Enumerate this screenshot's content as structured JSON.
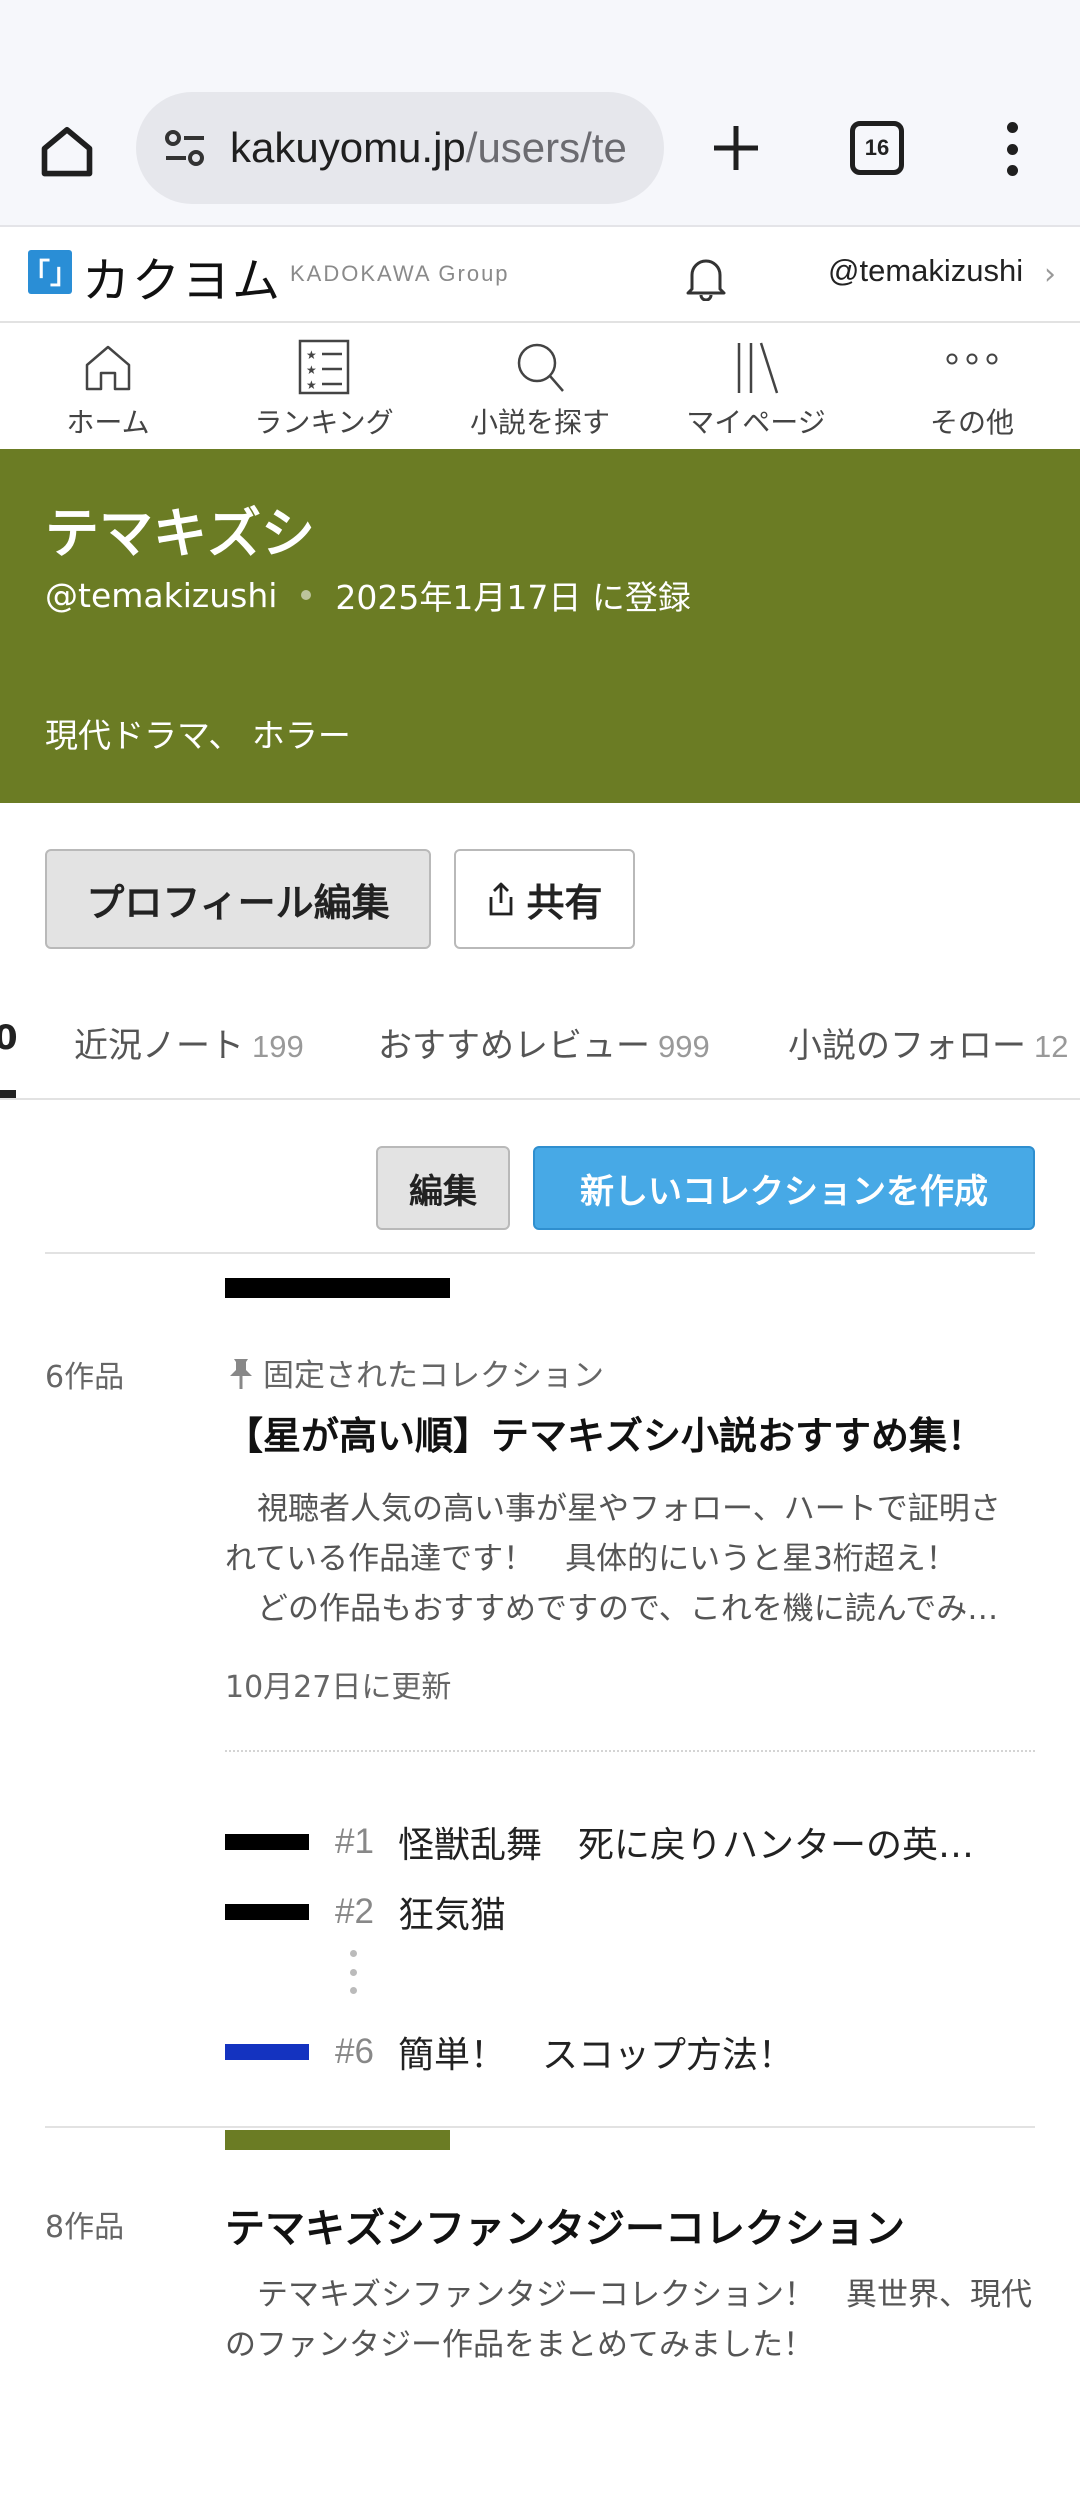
{
  "browser": {
    "url_main": "kakuyomu.jp",
    "url_rest": "/users/te",
    "tab_count": "16"
  },
  "header": {
    "logo_mark": "「」",
    "logo_text": "カクヨム",
    "group": "KADOKAWA Group",
    "user_handle": "@temakizushi"
  },
  "nav": {
    "items": [
      {
        "label": "ホーム",
        "icon": "home-icon"
      },
      {
        "label": "ランキング",
        "icon": "ranking-icon"
      },
      {
        "label": "小説を探す",
        "icon": "search-icon"
      },
      {
        "label": "マイページ",
        "icon": "mypage-icon"
      },
      {
        "label": "その他",
        "icon": "more-icon"
      }
    ]
  },
  "profile": {
    "name": "テマキズシ",
    "handle": "@temakizushi",
    "registered": "2025年1月17日 に登録",
    "genres": "現代ドラマ、 ホラー",
    "band_color": "#6b7c24"
  },
  "actions": {
    "edit_profile": "プロフィール編集",
    "share": "共有"
  },
  "tabs": {
    "first_partial": "0",
    "items": [
      {
        "label": "近況ノート",
        "count": "199"
      },
      {
        "label": "おすすめレビュー",
        "count": "999"
      },
      {
        "label": "小説のフォロー",
        "count": "12"
      }
    ]
  },
  "collection_actions": {
    "edit": "編集",
    "create": "新しいコレクションを作成",
    "create_color": "#47a9e6"
  },
  "collections": [
    {
      "count": "6作品",
      "pinned_label": "固定されたコレクション",
      "title": "【星が高い順】テマキズシ小説おすすめ集！",
      "desc_lines": [
        "視聴者人気の高い事が星やフォロー、ハートで証明さ",
        "れている作品達です！　具体的にいうと星3桁超え！",
        "どの作品もおすすめですので、これを機に読んでみ…"
      ],
      "updated": "10月27日に更新",
      "works": [
        {
          "num": "#1",
          "title": "怪獣乱舞　死に戻りハンターの英…",
          "color": "#000000"
        },
        {
          "num": "#2",
          "title": "狂気猫",
          "color": "#000000"
        },
        {
          "num": "#6",
          "title": "簡単！　スコップ方法！",
          "color": "#1433c0"
        }
      ]
    },
    {
      "count": "8作品",
      "title": "テマキズシファンタジーコレクション",
      "desc": "テマキズシファンタジーコレクション！　異世界、現代のファンタジー作品をまとめてみました！",
      "color": "#6b7c24"
    }
  ]
}
